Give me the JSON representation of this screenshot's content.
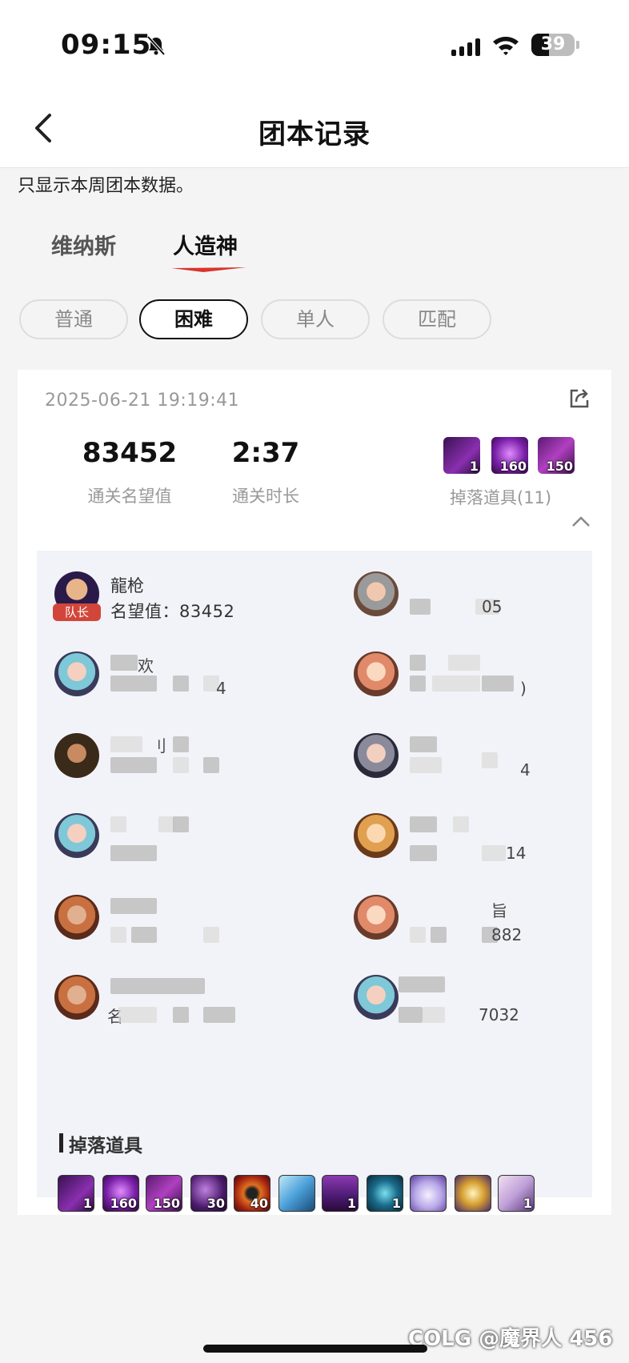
{
  "status": {
    "time": "09:15",
    "battery": "39"
  },
  "nav": {
    "title": "团本记录"
  },
  "notice": "只显示本周团本数据。",
  "raid_tabs": [
    "维纳斯",
    "人造神"
  ],
  "difficulty_chips": [
    "普通",
    "困难",
    "单人",
    "匹配"
  ],
  "record": {
    "date": "2025-06-21 19:19:41",
    "fame_value": "83452",
    "fame_label": "通关名望值",
    "duration_value": "2:37",
    "duration_label": "通关时长",
    "drops_label": "掉落道具(11)",
    "preview_counts": [
      "1",
      "160",
      "150"
    ]
  },
  "leader": {
    "tag": "队长",
    "name": "龍枪",
    "fame": "名望值：83452"
  },
  "visible_fragments": [
    "05",
    "欢",
    "4",
    ")",
    "刂",
    "4",
    "14",
    "旨",
    "882",
    "名",
    "7032"
  ],
  "drops_section": {
    "title": "掉落道具",
    "counts": [
      "1",
      "160",
      "150",
      "30",
      "40",
      "",
      "1",
      "1",
      "",
      "",
      "1"
    ]
  },
  "colors": {
    "accent": "#d9342b",
    "leader_tag": "#d2463a"
  },
  "watermark": "COLG @魔界人 456"
}
